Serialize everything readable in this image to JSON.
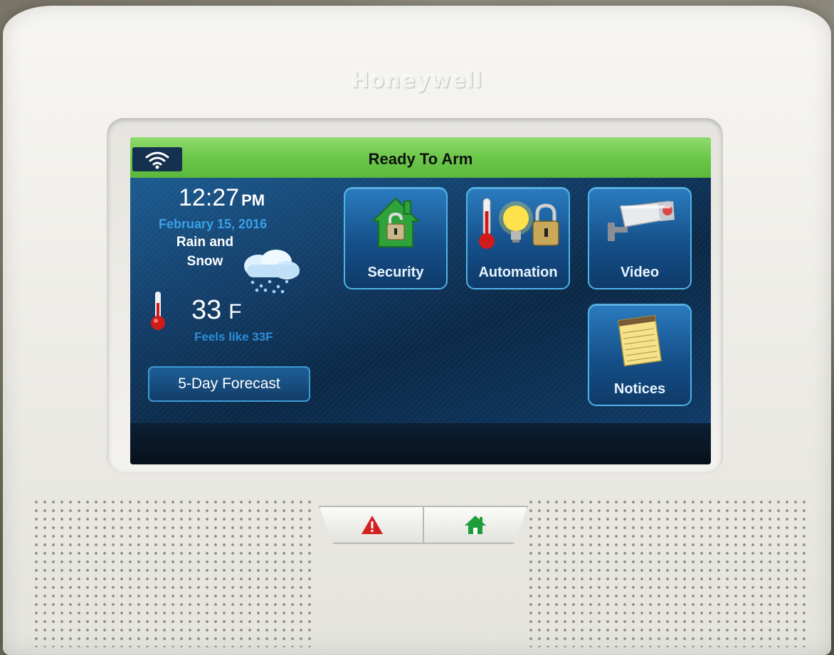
{
  "device": {
    "brand": "Honeywell"
  },
  "status_bar": {
    "text": "Ready To Arm",
    "wifi_icon": "wifi-icon",
    "color": "#6cc84a"
  },
  "weather": {
    "time": "12:27",
    "ampm": "PM",
    "date": "February 15, 2016",
    "condition_line1": "Rain and",
    "condition_line2": "Snow",
    "condition_icon": "rain-snow-cloud-icon",
    "temperature": "33",
    "temperature_unit": "F",
    "feels_like": "Feels like 33F",
    "forecast_button": "5-Day Forecast"
  },
  "tiles": {
    "security": {
      "label": "Security",
      "icon": "house-padlock-icon"
    },
    "automation": {
      "label": "Automation",
      "icon": "thermometer-bulb-lock-icon"
    },
    "video": {
      "label": "Video",
      "icon": "security-camera-icon"
    },
    "notices": {
      "label": "Notices",
      "icon": "notepad-icon"
    }
  },
  "hardware_buttons": {
    "emergency": {
      "icon": "warning-triangle-icon",
      "color": "#d32020"
    },
    "home": {
      "icon": "home-icon",
      "color": "#1e9e3a"
    }
  }
}
